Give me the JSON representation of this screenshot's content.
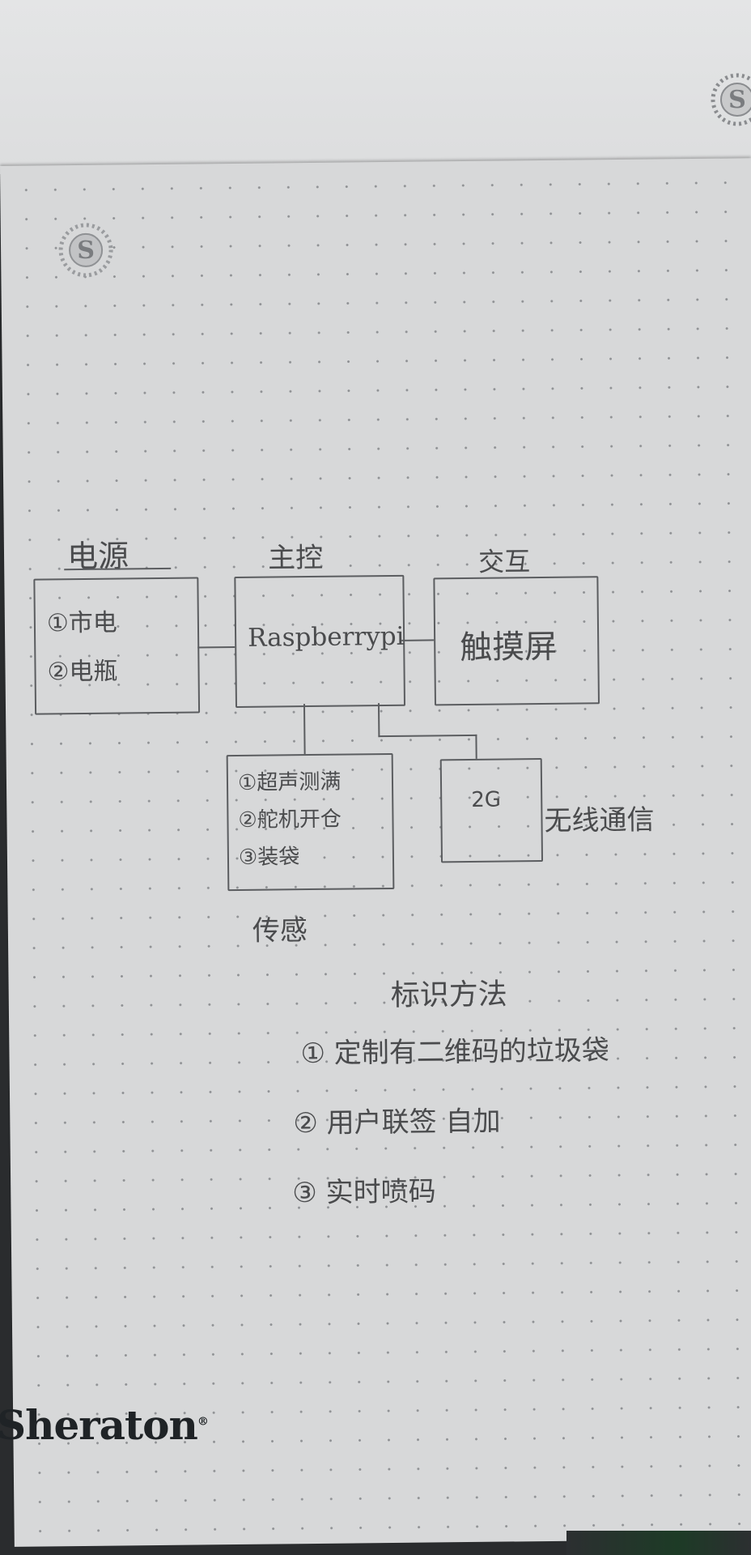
{
  "logos": {
    "seal_letter": "S",
    "brand": "Sheraton"
  },
  "diagram": {
    "power": {
      "title": "电源",
      "items": [
        "①市电",
        "②电瓶"
      ]
    },
    "controller": {
      "title": "主控",
      "label": "Raspberrypi"
    },
    "interaction": {
      "title": "交互",
      "label": "触摸屏"
    },
    "sensor": {
      "title": "传感",
      "items": [
        "①超声测满",
        "②舵机开仓",
        "③装袋"
      ]
    },
    "wireless": {
      "label": "2G",
      "title": "无线通信"
    }
  },
  "methods": {
    "title": "标识方法",
    "items": [
      "① 定制有二维码的垃圾袋",
      "② 用户联签 自加",
      "③ 实时喷码"
    ]
  },
  "colors": {
    "paper": "#d7d8d9",
    "ink": "#4a4b4d",
    "brand": "#1f2326"
  }
}
